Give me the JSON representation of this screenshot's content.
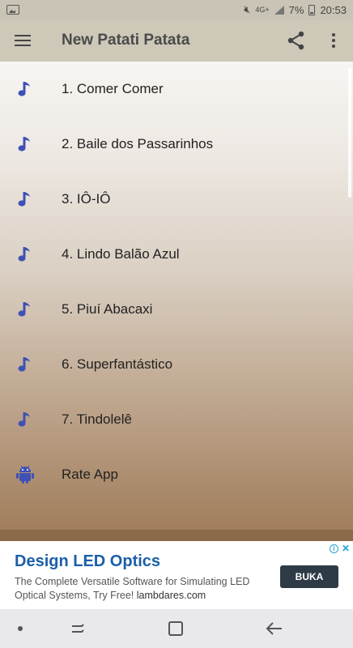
{
  "status_bar": {
    "network": "4G+",
    "battery": "7%",
    "time": "20:53"
  },
  "app_bar": {
    "title": "New Patati Patata"
  },
  "songs": [
    {
      "label": "1. Comer Comer",
      "icon": "music-note-icon"
    },
    {
      "label": "2. Baile dos Passarinhos",
      "icon": "music-note-icon"
    },
    {
      "label": "3. IÔ-IÔ",
      "icon": "music-note-icon"
    },
    {
      "label": "4. Lindo Balão Azul",
      "icon": "music-note-icon"
    },
    {
      "label": "5. Piuí Abacaxi",
      "icon": "music-note-icon"
    },
    {
      "label": "6. Superfantástico",
      "icon": "music-note-icon"
    },
    {
      "label": "7. Tindolelê",
      "icon": "music-note-icon"
    }
  ],
  "rate_app": {
    "label": "Rate App",
    "icon": "android-icon"
  },
  "ad": {
    "title": "Design LED Optics",
    "text": "The Complete Versatile Software for Simulating LED Optical Systems, Try Free!",
    "domain": "lambdares.com",
    "button": "BUKA"
  },
  "colors": {
    "accent_icon": "#3f51b5",
    "app_bar": "#cdc8b8",
    "ad_title": "#1a5fa8"
  }
}
